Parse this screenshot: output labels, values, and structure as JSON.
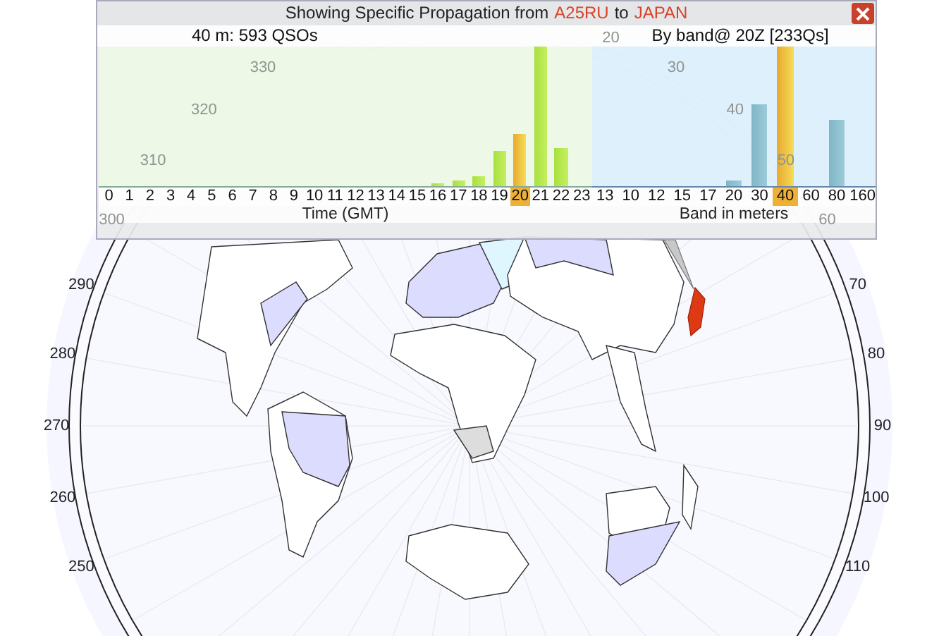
{
  "panel": {
    "title": {
      "prefix": "Showing Specific Propagation from",
      "source": "A25RU",
      "joiner": "to",
      "target": "JAPAN"
    },
    "left_chart": {
      "summary": "40 m: 593 QSOs",
      "axis_title": "Time (GMT)",
      "bars": [
        {
          "label": "0",
          "selected": false
        },
        {
          "label": "1",
          "selected": false
        },
        {
          "label": "2",
          "selected": false
        },
        {
          "label": "3",
          "selected": false
        },
        {
          "label": "4",
          "selected": false
        },
        {
          "label": "5",
          "selected": false
        },
        {
          "label": "6",
          "selected": false
        },
        {
          "label": "7",
          "selected": false
        },
        {
          "label": "8",
          "selected": false
        },
        {
          "label": "9",
          "selected": false
        },
        {
          "label": "10",
          "selected": false
        },
        {
          "label": "11",
          "selected": false
        },
        {
          "label": "12",
          "selected": false
        },
        {
          "label": "13",
          "selected": false
        },
        {
          "label": "14",
          "selected": false
        },
        {
          "label": "15",
          "selected": false
        },
        {
          "label": "16",
          "selected": false
        },
        {
          "label": "17",
          "selected": false
        },
        {
          "label": "18",
          "selected": false
        },
        {
          "label": "19",
          "selected": false
        },
        {
          "label": "20",
          "selected": true
        },
        {
          "label": "21",
          "selected": false
        },
        {
          "label": "22",
          "selected": false
        },
        {
          "label": "23",
          "selected": false
        }
      ]
    },
    "right_chart": {
      "summary": "By band@ 20Z [233Qs]",
      "axis_title": "Band in meters",
      "bars": [
        {
          "label": "13",
          "selected": false
        },
        {
          "label": "10",
          "selected": false
        },
        {
          "label": "12",
          "selected": false
        },
        {
          "label": "15",
          "selected": false
        },
        {
          "label": "17",
          "selected": false
        },
        {
          "label": "20",
          "selected": false
        },
        {
          "label": "30",
          "selected": false
        },
        {
          "label": "40",
          "selected": true
        },
        {
          "label": "60",
          "selected": false
        },
        {
          "label": "80",
          "selected": false
        },
        {
          "label": "160",
          "selected": false
        }
      ]
    }
  },
  "map": {
    "bearing_labels": [
      {
        "text": "330",
        "faint": true
      },
      {
        "text": "320",
        "faint": true
      },
      {
        "text": "310",
        "faint": true
      },
      {
        "text": "300",
        "faint": true
      },
      {
        "text": "290",
        "faint": false
      },
      {
        "text": "280",
        "faint": false
      },
      {
        "text": "270",
        "faint": false
      },
      {
        "text": "260",
        "faint": false
      },
      {
        "text": "250",
        "faint": false
      },
      {
        "text": "20",
        "faint": true
      },
      {
        "text": "30",
        "faint": true
      },
      {
        "text": "40",
        "faint": true
      },
      {
        "text": "50",
        "faint": true
      },
      {
        "text": "60",
        "faint": true
      },
      {
        "text": "70",
        "faint": false
      },
      {
        "text": "80",
        "faint": false
      },
      {
        "text": "90",
        "faint": false
      },
      {
        "text": "100",
        "faint": false
      },
      {
        "text": "110",
        "faint": false
      }
    ]
  }
}
